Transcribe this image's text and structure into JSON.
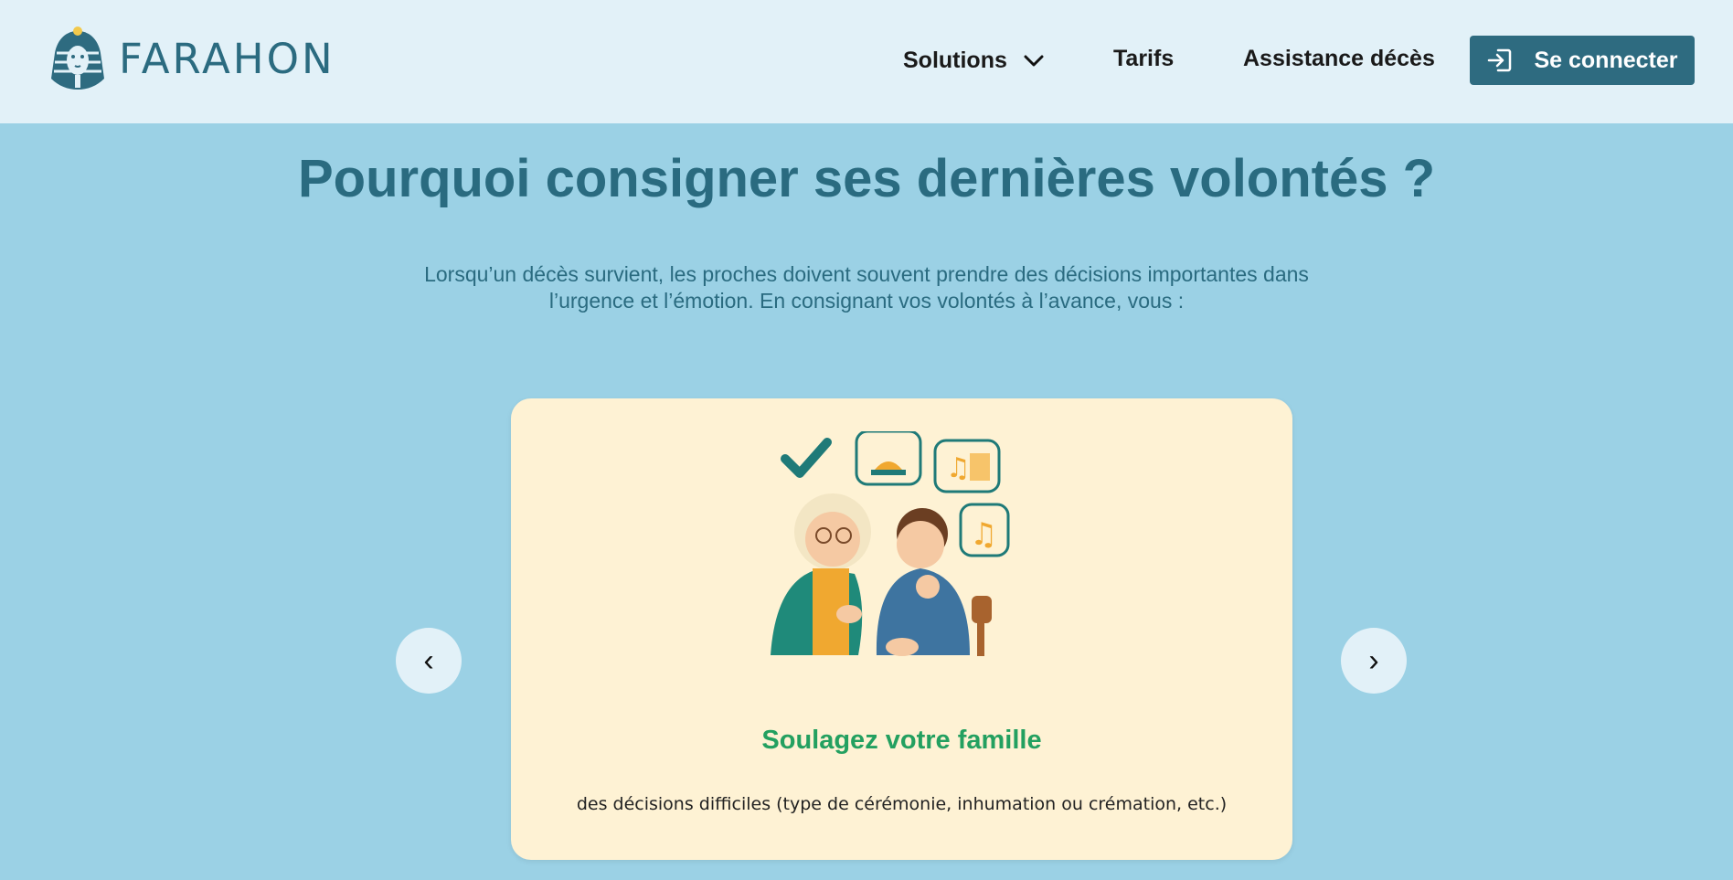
{
  "header": {
    "logo_text": "FARAHON",
    "nav": {
      "solutions": "Solutions",
      "tarifs": "Tarifs",
      "assistance": "Assistance décès"
    },
    "login_label": "Se connecter"
  },
  "main": {
    "title": "Pourquoi consigner ses dernières volontés ?",
    "intro_line1": "Lorsqu’un décès survient, les proches doivent souvent prendre des décisions importantes dans",
    "intro_line2": "l’urgence et l’émotion. En consignant vos volontés à l’avance, vous :"
  },
  "carousel": {
    "prev": "‹",
    "next": "›",
    "current_slide": {
      "title": "Soulagez votre famille",
      "text": "des décisions difficiles (type de cérémonie, inhumation ou crémation, etc.)"
    }
  },
  "colors": {
    "header_bg": "#e2f1f8",
    "page_bg": "#9bd1e5",
    "brand": "#2e6b80",
    "card_bg": "#fef2d4",
    "accent_green": "#23a060"
  }
}
